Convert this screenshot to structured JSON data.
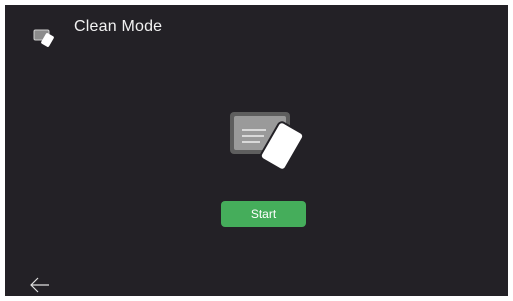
{
  "header": {
    "title": "Clean Mode",
    "icon": "clean-card-icon"
  },
  "main": {
    "illustration": "clean-card-icon",
    "start_label": "Start"
  },
  "footer": {
    "back_icon": "arrow-left-icon"
  },
  "colors": {
    "background": "#232126",
    "accent": "#45ad5b",
    "text": "#f2f2f2"
  }
}
